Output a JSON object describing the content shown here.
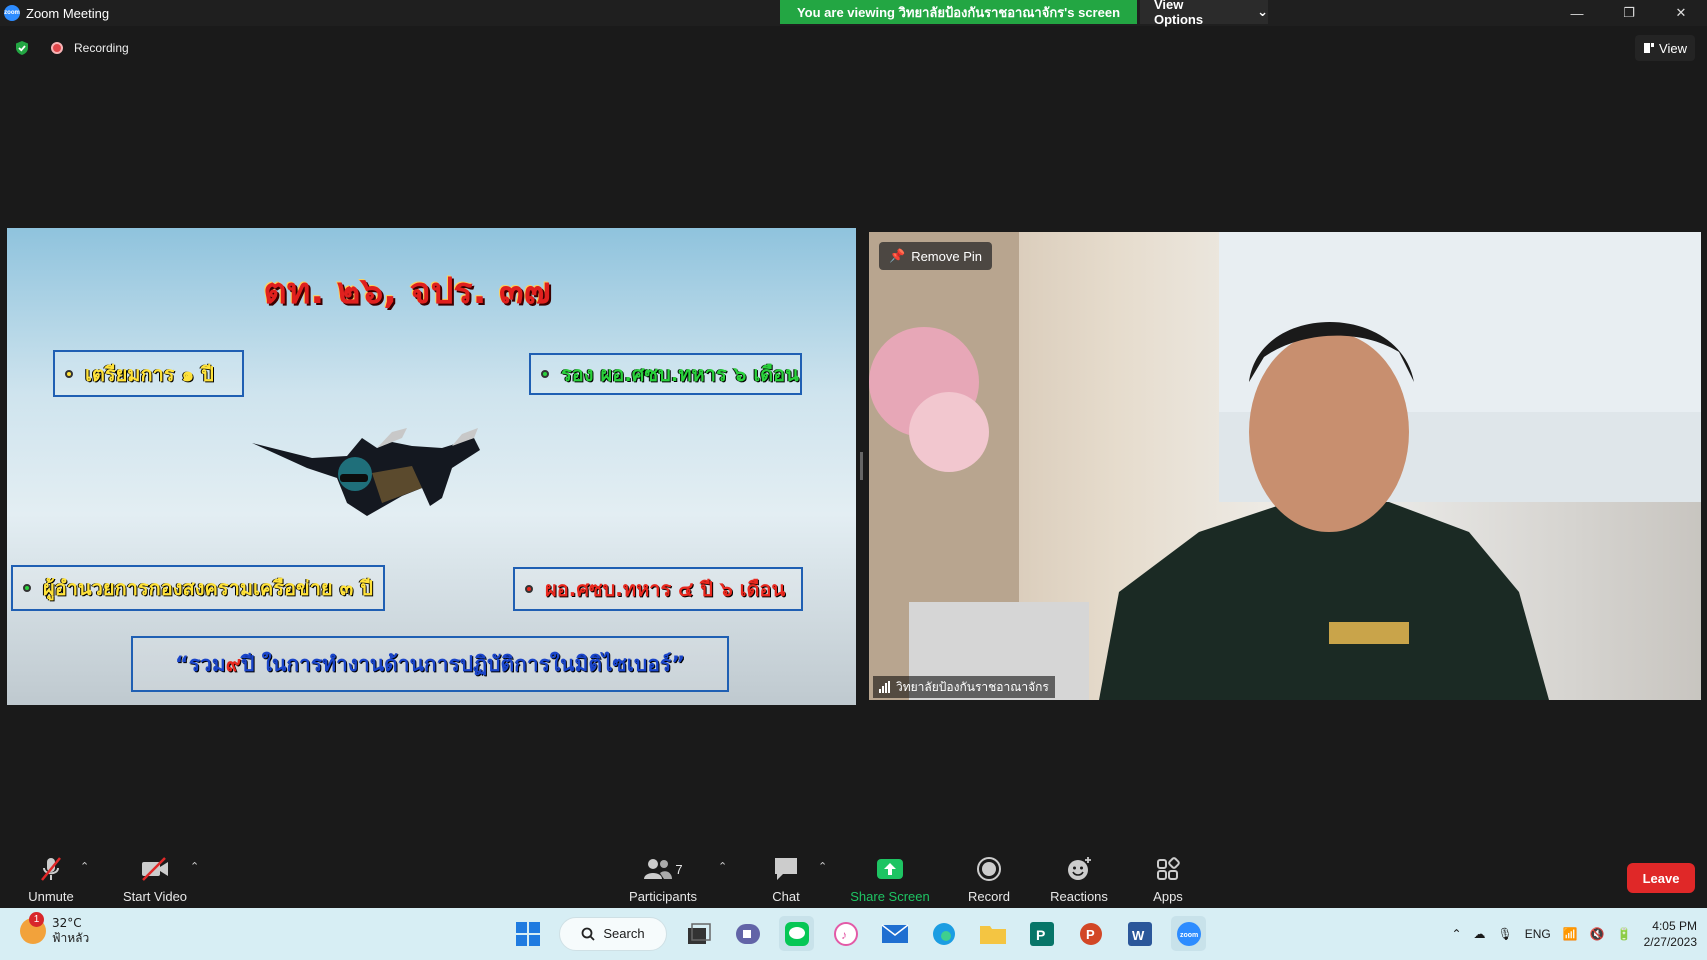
{
  "window": {
    "title": "Zoom Meeting",
    "banner": "You are viewing วิทยาลัยป้องกันราชอาณาจักร's screen",
    "view_options": "View Options"
  },
  "status": {
    "recording": "Recording",
    "view": "View"
  },
  "slide": {
    "title": "ตท. ๒๖, จปร. ๓๗",
    "box1": "เตรียมการ ๑ ปี",
    "box2": "รอง ผอ.ศซบ.ทหาร ๖ เดือน",
    "box3": "ผู้อำนวยการกองสงครามเครือข่าย ๓ ปี",
    "box4": "ผอ.ศซบ.ทหาร ๔ ปี ๖ เดือน",
    "summary_pre": "“รวม ",
    "summary_num": "๙",
    "summary_post": " ปี ในการทำงานด้านการปฏิบัติการในมิติไซเบอร์”"
  },
  "camera": {
    "remove_pin": "Remove Pin",
    "participant_name": "วิทยาลัยป้องกันราชอาณาจักร"
  },
  "toolbar": {
    "unmute": "Unmute",
    "start_video": "Start Video",
    "participants": "Participants",
    "participants_count": "7",
    "chat": "Chat",
    "share_screen": "Share Screen",
    "record": "Record",
    "reactions": "Reactions",
    "apps": "Apps",
    "leave": "Leave"
  },
  "taskbar": {
    "temperature": "32°C",
    "weather_desc": "ฟ้าหลัว",
    "weather_badge": "1",
    "search": "Search",
    "lang": "ENG",
    "time": "4:05 PM",
    "date": "2/27/2023"
  },
  "colors": {
    "banner_green": "#23a643",
    "leave_red": "#e02828",
    "share_green": "#1ec463",
    "zoom_blue": "#2d8cff"
  }
}
